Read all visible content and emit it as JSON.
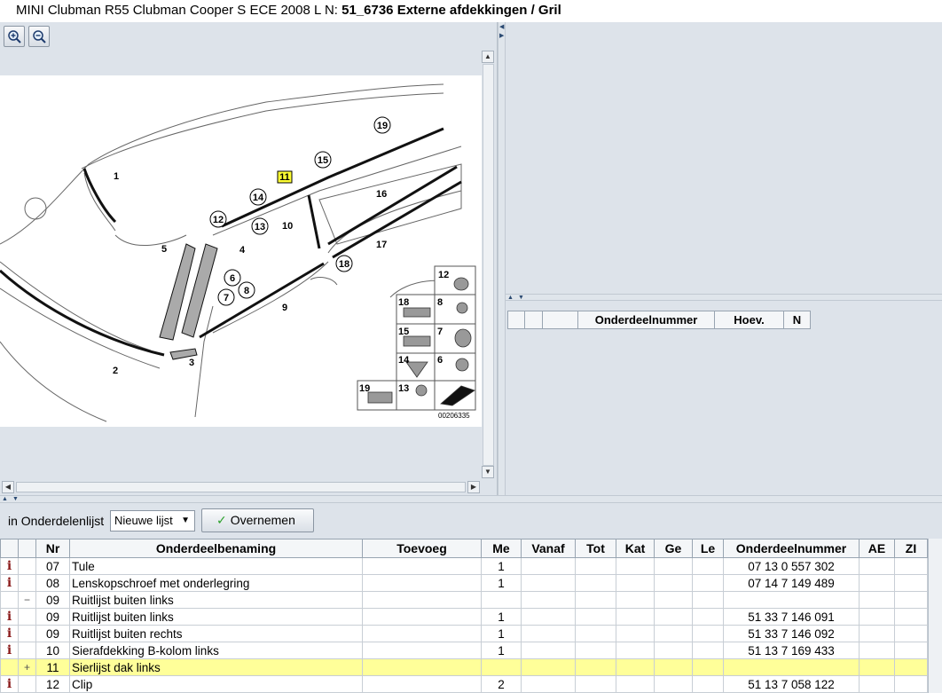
{
  "window": {
    "title_prefix": "MINI Clubman R55 Clubman Cooper S ECE 2008  L N: ",
    "title_bold": "51_6736 Externe afdekkingen / Gril"
  },
  "diagram": {
    "image_id": "00206335",
    "callouts": [
      "1",
      "2",
      "3",
      "4",
      "5",
      "6",
      "7",
      "8",
      "9",
      "10",
      "11",
      "12",
      "13",
      "14",
      "15",
      "16",
      "17",
      "18",
      "19"
    ],
    "highlight_callout": "11",
    "inset_labels": [
      "12",
      "18",
      "8",
      "15",
      "7",
      "14",
      "6",
      "19",
      "13"
    ]
  },
  "right_table": {
    "headers": [
      "",
      "",
      "",
      "Onderdeelnummer",
      "Hoev.",
      "N"
    ]
  },
  "toolbar": {
    "list_label": "in Onderdelenlijst",
    "list_select": "Nieuwe lijst",
    "accept_label": "Overnemen"
  },
  "parts_table": {
    "headers": [
      "",
      "",
      "Nr",
      "Onderdeelbenaming",
      "Toevoeg",
      "Me",
      "Vanaf",
      "Tot",
      "Kat",
      "Ge",
      "Le",
      "Onderdeelnummer",
      "AE",
      "ZI"
    ],
    "rows": [
      {
        "icon": "i",
        "toggle": "",
        "nr": "07",
        "name": "Tule",
        "add": "",
        "me": "1",
        "part": "07 13 0 557 302",
        "hl": false
      },
      {
        "icon": "i",
        "toggle": "",
        "nr": "08",
        "name": "Lenskopschroef met onderlegring",
        "add": "",
        "me": "1",
        "part": "07 14 7 149 489",
        "hl": false
      },
      {
        "icon": "",
        "toggle": "−",
        "nr": "09",
        "name": "Ruitlijst buiten links",
        "add": "",
        "me": "",
        "part": "",
        "hl": false
      },
      {
        "icon": "i",
        "toggle": "",
        "nr": "09",
        "name": "Ruitlijst buiten links",
        "add": "",
        "me": "1",
        "part": "51 33 7 146 091",
        "hl": false
      },
      {
        "icon": "i",
        "toggle": "",
        "nr": "09",
        "name": "Ruitlijst buiten rechts",
        "add": "",
        "me": "1",
        "part": "51 33 7 146 092",
        "hl": false
      },
      {
        "icon": "i",
        "toggle": "",
        "nr": "10",
        "name": "Sierafdekking B-kolom links",
        "add": "",
        "me": "1",
        "part": "51 13 7 169 433",
        "hl": false
      },
      {
        "icon": "",
        "toggle": "+",
        "nr": "11",
        "name": "Sierlijst dak links",
        "add": "",
        "me": "",
        "part": "",
        "hl": true
      },
      {
        "icon": "i",
        "toggle": "",
        "nr": "12",
        "name": "Clip",
        "add": "",
        "me": "2",
        "part": "51 13 7 058 122",
        "hl": false
      }
    ]
  },
  "colors": {
    "highlight_row": "#ffff99",
    "panel_bg": "#dde3ea",
    "info_icon": "#8b1c1c",
    "accept_check": "#2aa02a"
  }
}
